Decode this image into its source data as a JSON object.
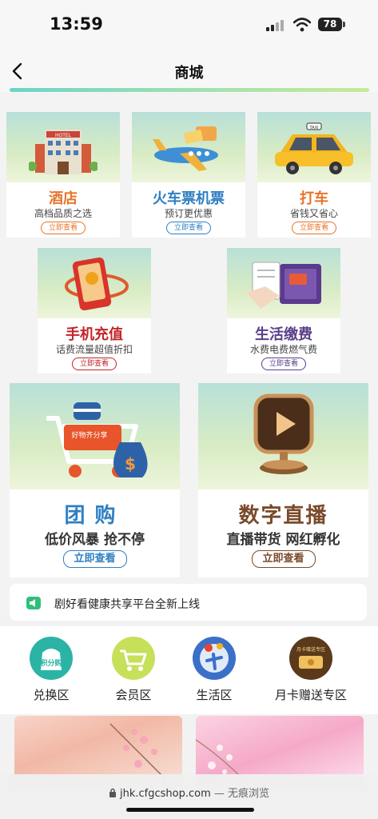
{
  "status_bar": {
    "time": "13:59",
    "battery": "78"
  },
  "nav": {
    "title": "商城"
  },
  "cards": {
    "hotel": {
      "title": "酒店",
      "subtitle": "高档品质之选",
      "button": "立即查看"
    },
    "train": {
      "title": "火车票机票",
      "subtitle": "预订更优惠",
      "button": "立即查看"
    },
    "taxi": {
      "title": "打车",
      "subtitle": "省钱又省心",
      "button": "立即查看",
      "sign": "TAXI"
    },
    "recharge": {
      "title": "手机充值",
      "subtitle": "话费流量超值折扣",
      "button": "立即查看"
    },
    "utility": {
      "title": "生活缴费",
      "subtitle": "水费电费燃气费",
      "button": "立即查看"
    },
    "group": {
      "title": "团购",
      "subtitle": "低价风暴 抢不停",
      "button": "立即查看",
      "tag": "好物齐分享",
      "hotel_sign": "HOTEL"
    },
    "live": {
      "title": "数字直播",
      "subtitle": "直播带货 网红孵化",
      "button": "立即查看"
    }
  },
  "announcement": {
    "text": "剧好看健康共享平台全新上线"
  },
  "zones": [
    {
      "label": "兑换区",
      "icon_text": "积分购"
    },
    {
      "label": "会员区",
      "icon_text": ""
    },
    {
      "label": "生活区",
      "icon_text": ""
    },
    {
      "label": "月卡赠送专区",
      "icon_text": "月卡赠送专区"
    }
  ],
  "browser": {
    "url": "jhk.cfgcshop.com",
    "suffix": "— 无痕浏览"
  },
  "colors": {
    "accent_teal": "#6fd3c8",
    "orange": "#e8742a",
    "blue": "#2f7fc2",
    "red": "#c2252a",
    "purple": "#5a3f8a",
    "brown": "#7a4a2a"
  }
}
